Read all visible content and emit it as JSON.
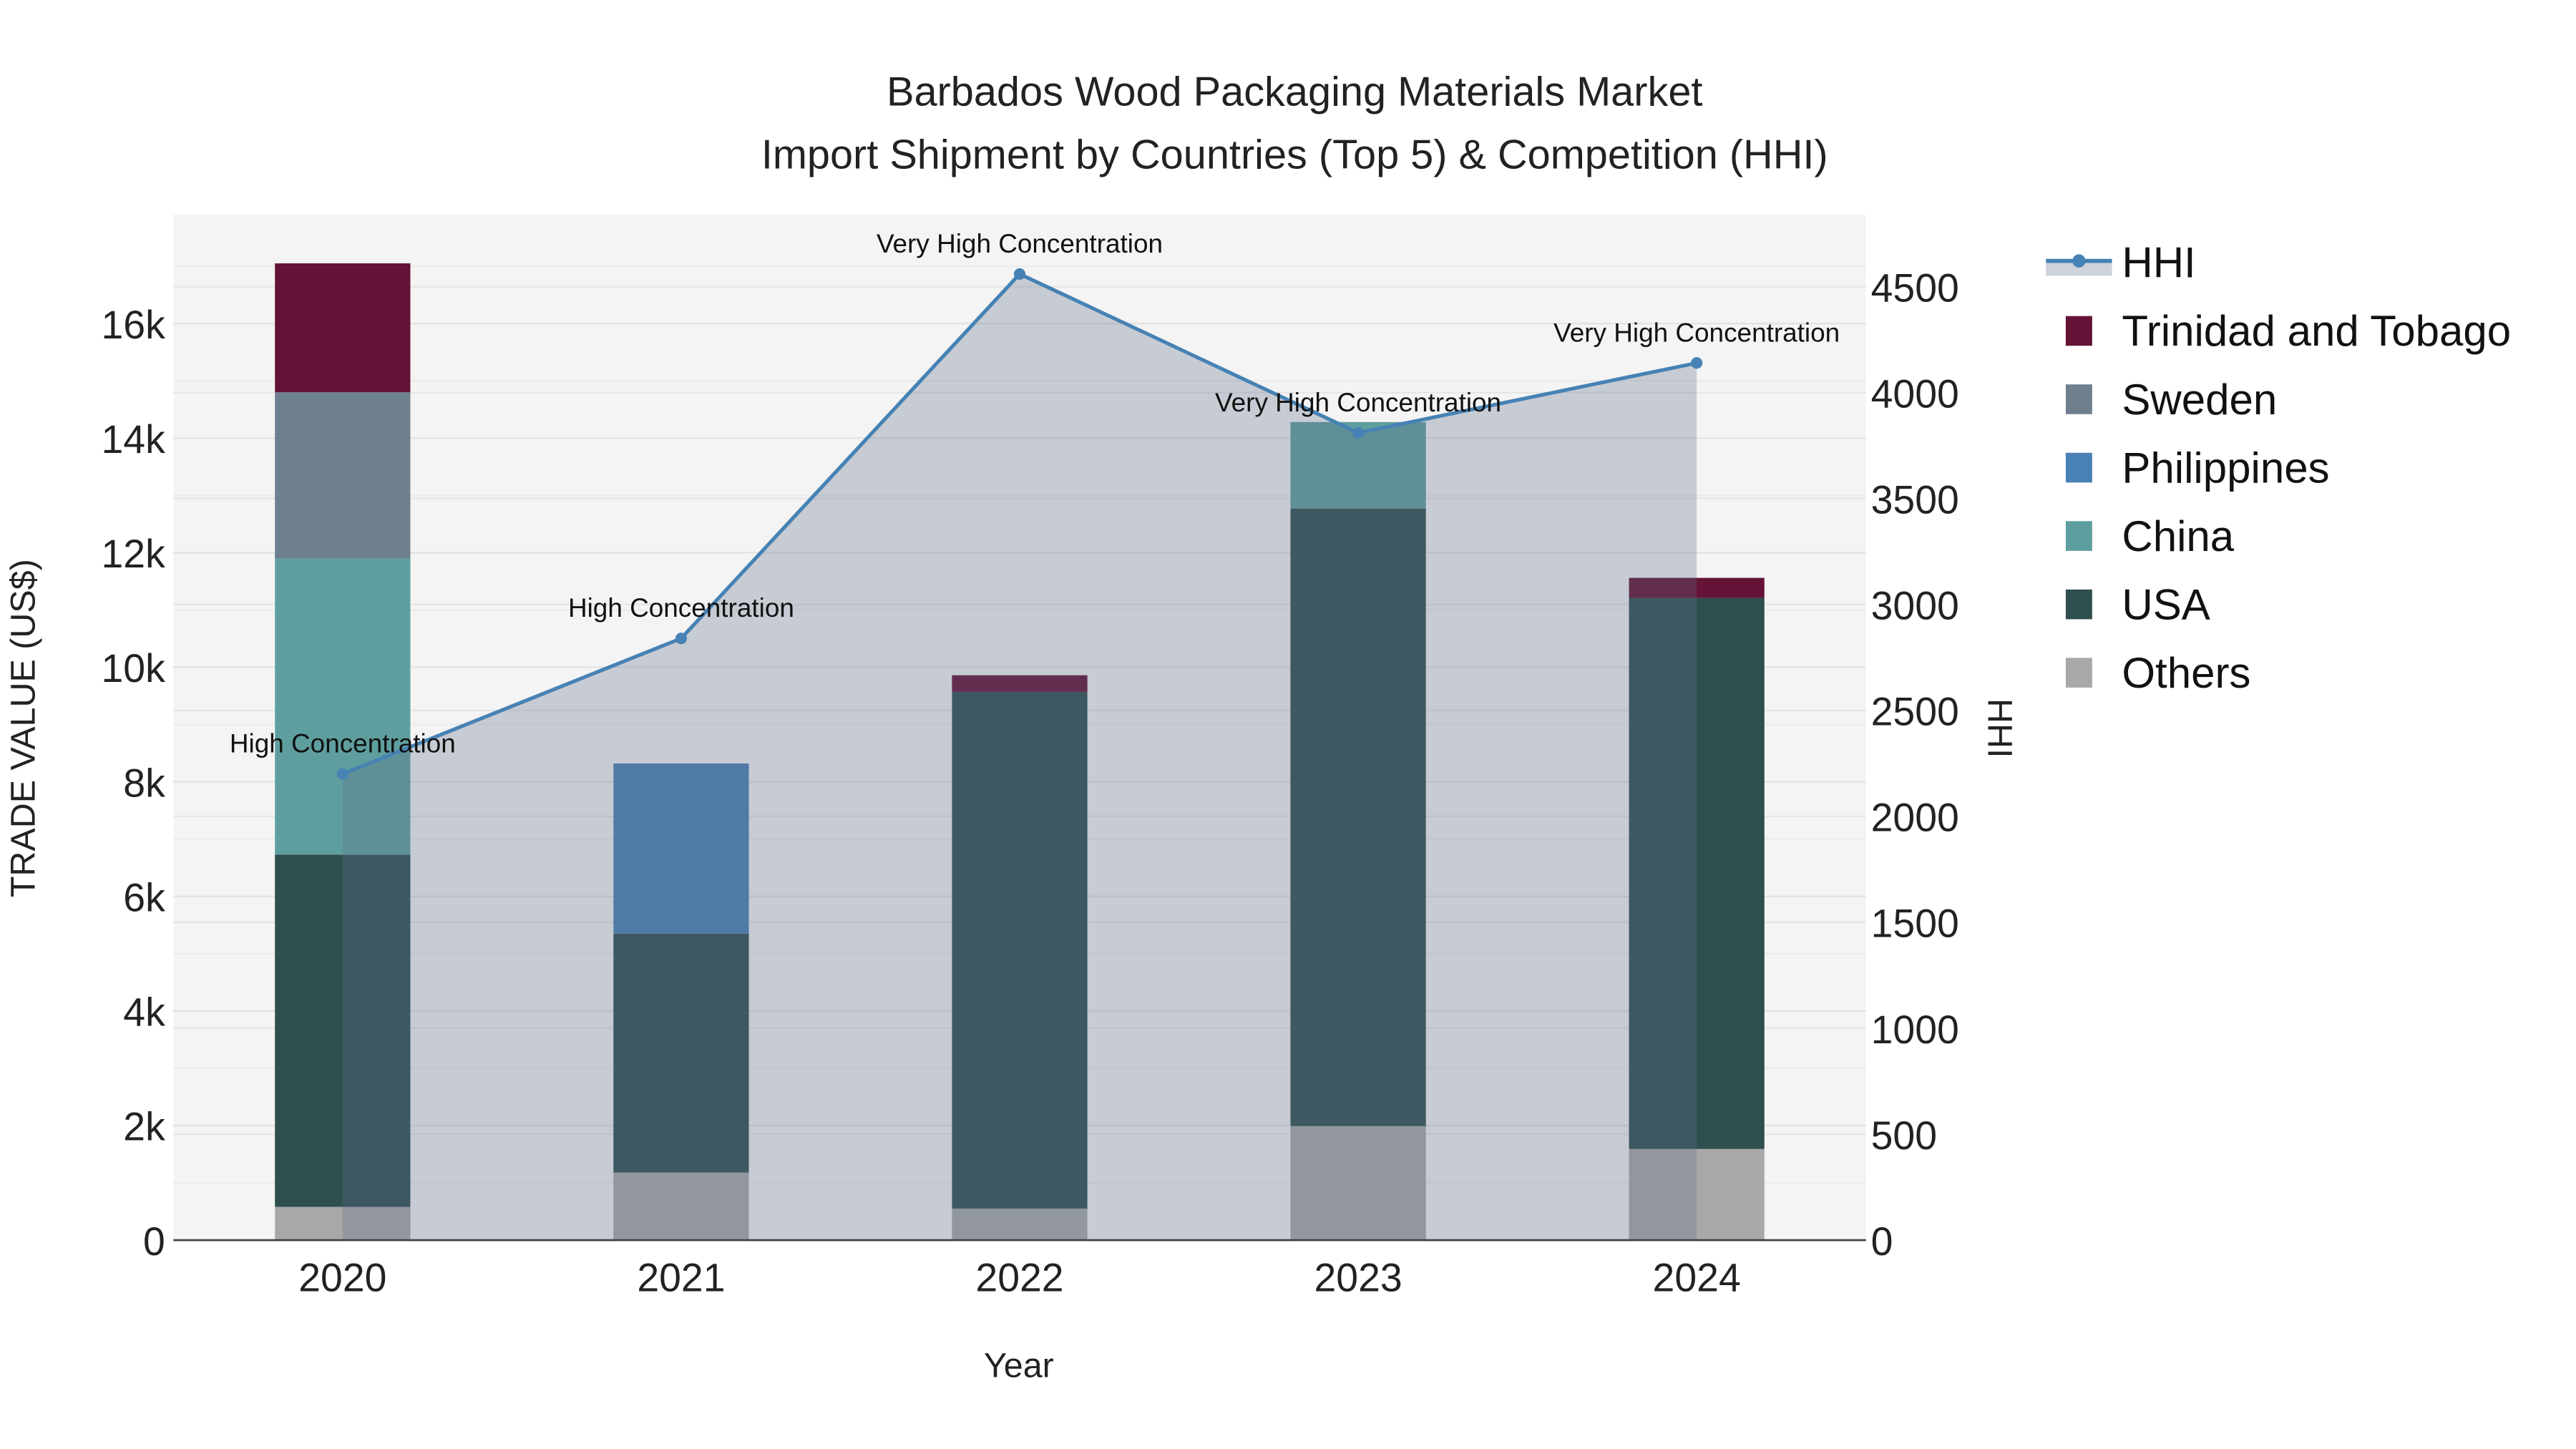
{
  "chart_data": {
    "type": "bar",
    "title_line1": "Barbados Wood Packaging Materials Market",
    "title_line2": "Import Shipment by Countries (Top 5) & Competition (HHI)",
    "xlabel": "Year",
    "ylabel": "TRADE VALUE (US$)",
    "y2label": "HHI",
    "categories": [
      "2020",
      "2021",
      "2022",
      "2023",
      "2024"
    ],
    "ylim": [
      0,
      17900
    ],
    "y_ticks": [
      0,
      2000,
      4000,
      6000,
      8000,
      10000,
      12000,
      14000,
      16000
    ],
    "y_tick_labels": [
      "0",
      "2k",
      "4k",
      "6k",
      "8k",
      "10k",
      "12k",
      "14k",
      "16k"
    ],
    "y2lim": [
      0,
      4840
    ],
    "y2_ticks": [
      0,
      500,
      1000,
      1500,
      2000,
      2500,
      3000,
      3500,
      4000,
      4500
    ],
    "y2_tick_labels": [
      "0",
      "500",
      "1000",
      "1500",
      "2000",
      "2500",
      "3000",
      "3500",
      "4000",
      "4500"
    ],
    "grid": true,
    "legend_position": "right",
    "stacked": true,
    "series": [
      {
        "name": "Others",
        "color": "#a8a8a8",
        "values": [
          580,
          1180,
          550,
          1990,
          1590
        ]
      },
      {
        "name": "USA",
        "color": "#2f4f4f",
        "values": [
          6150,
          4170,
          9020,
          10780,
          9620
        ]
      },
      {
        "name": "China",
        "color": "#5f9e9e",
        "values": [
          5170,
          0,
          0,
          1510,
          0
        ]
      },
      {
        "name": "Philippines",
        "color": "#4a81b4",
        "values": [
          0,
          2970,
          0,
          0,
          0
        ]
      },
      {
        "name": "Sweden",
        "color": "#6e7f8e",
        "values": [
          2900,
          0,
          0,
          0,
          0
        ]
      },
      {
        "name": "Trinidad and Tobago",
        "color": "#641236",
        "values": [
          2250,
          0,
          290,
          0,
          350
        ]
      }
    ],
    "legend_order": [
      "HHI",
      "Trinidad and Tobago",
      "Sweden",
      "Philippines",
      "China",
      "USA",
      "Others"
    ],
    "hhi": {
      "name": "HHI",
      "color": "#4682b4",
      "values": [
        2200,
        2840,
        4560,
        3810,
        4140
      ],
      "annotations": [
        "High Concentration",
        "High Concentration",
        "Very High Concentration",
        "Very High Concentration",
        "Very High Concentration"
      ]
    }
  }
}
